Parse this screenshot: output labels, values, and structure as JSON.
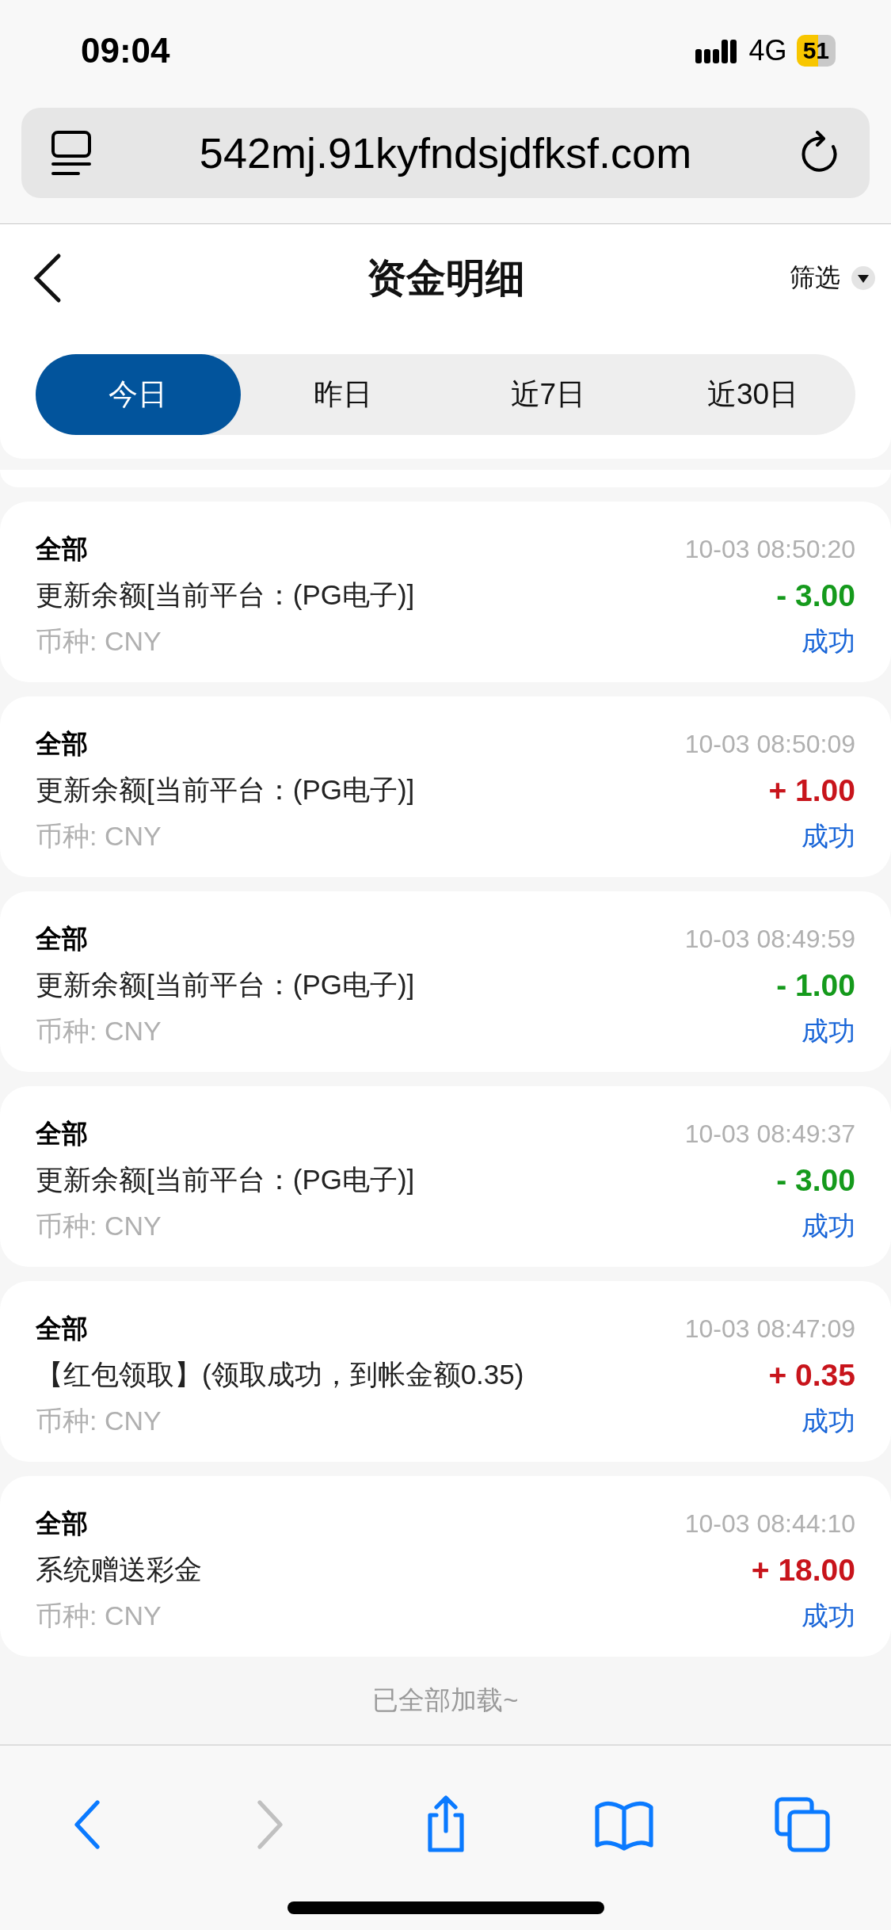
{
  "status_bar": {
    "time": "09:04",
    "network": "4G",
    "battery": "51"
  },
  "address_bar": {
    "url": "542mj.91kyfndsjdfksf.com"
  },
  "header": {
    "title": "资金明细",
    "filter": "筛选"
  },
  "tabs": [
    {
      "label": "今日",
      "selected": true
    },
    {
      "label": "昨日",
      "selected": false
    },
    {
      "label": "近7日",
      "selected": false
    },
    {
      "label": "近30日",
      "selected": false
    }
  ],
  "records": [
    {
      "type": "全部",
      "time": "10-03 08:50:20",
      "description": "更新余额[当前平台：(PG电子)]",
      "amount": "- 3.00",
      "kind": "expense",
      "currency": "币种: CNY",
      "status": "成功"
    },
    {
      "type": "全部",
      "time": "10-03 08:50:09",
      "description": "更新余额[当前平台：(PG电子)]",
      "amount": "+ 1.00",
      "kind": "income",
      "currency": "币种: CNY",
      "status": "成功"
    },
    {
      "type": "全部",
      "time": "10-03 08:49:59",
      "description": "更新余额[当前平台：(PG电子)]",
      "amount": "- 1.00",
      "kind": "expense",
      "currency": "币种: CNY",
      "status": "成功"
    },
    {
      "type": "全部",
      "time": "10-03 08:49:37",
      "description": "更新余额[当前平台：(PG电子)]",
      "amount": "- 3.00",
      "kind": "expense",
      "currency": "币种: CNY",
      "status": "成功"
    },
    {
      "type": "全部",
      "time": "10-03 08:47:09",
      "description": "【红包领取】(领取成功，到帐金额0.35)",
      "amount": "+ 0.35",
      "kind": "income",
      "currency": "币种: CNY",
      "status": "成功"
    },
    {
      "type": "全部",
      "time": "10-03 08:44:10",
      "description": "系统赠送彩金",
      "amount": "+ 18.00",
      "kind": "income",
      "currency": "币种: CNY",
      "status": "成功"
    }
  ],
  "footer_note": "已全部加载~",
  "toolbar": [
    {
      "kind": "back",
      "disabled": false
    },
    {
      "kind": "forward",
      "disabled": true
    },
    {
      "kind": "share",
      "disabled": false
    },
    {
      "kind": "bookmarks",
      "disabled": false
    },
    {
      "kind": "tabs",
      "disabled": false
    }
  ]
}
